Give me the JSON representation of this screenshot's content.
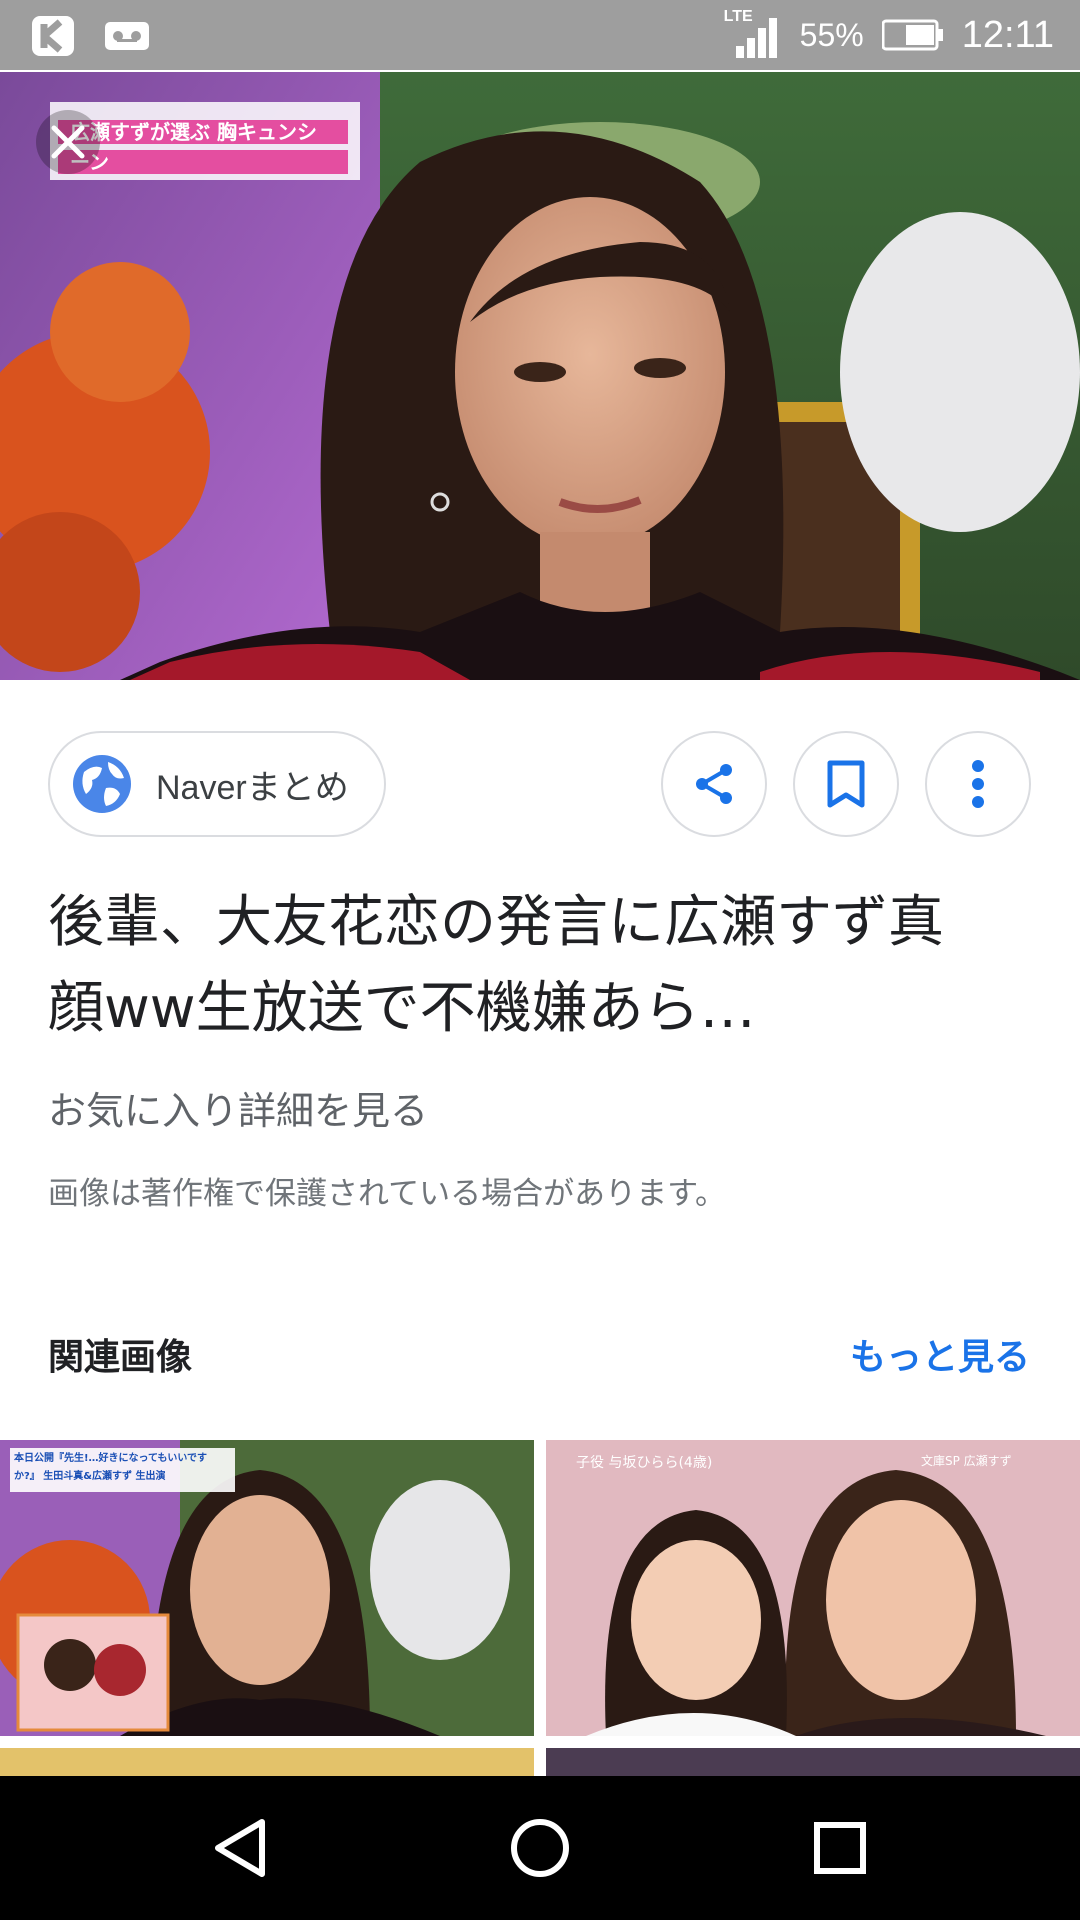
{
  "status_bar": {
    "network": "LTE",
    "battery": "55%",
    "time": "12:11"
  },
  "source": {
    "label": "Naverまとめ"
  },
  "article": {
    "title": "後輩、大友花恋の発言に広瀬すず真顔ww生放送で不機嫌あら…",
    "details_link": "お気に入り詳細を見る",
    "copyright_notice": "画像は著作権で保護されている場合があります。"
  },
  "related": {
    "heading": "関連画像",
    "more_label": "もっと見る"
  },
  "image_captions": {
    "hero_banner": "広瀬すずが選ぶ 胸キュンシーン",
    "thumb1_banner": "本日公開『先生!…好きになってもいいですか?』 生田斗真&広瀬すず 生出演",
    "thumb2_left": "子役 与坂ひらら(4歳)",
    "thumb2_right": "文庫SP 広瀬すず"
  },
  "colors": {
    "accent": "#1a73e8",
    "status_bar": "#9e9e9e",
    "nav_bar": "#000000"
  },
  "icons": [
    "close-icon",
    "globe-icon",
    "share-icon",
    "bookmark-icon",
    "more-vert-icon",
    "back-icon",
    "home-icon",
    "recents-icon"
  ]
}
